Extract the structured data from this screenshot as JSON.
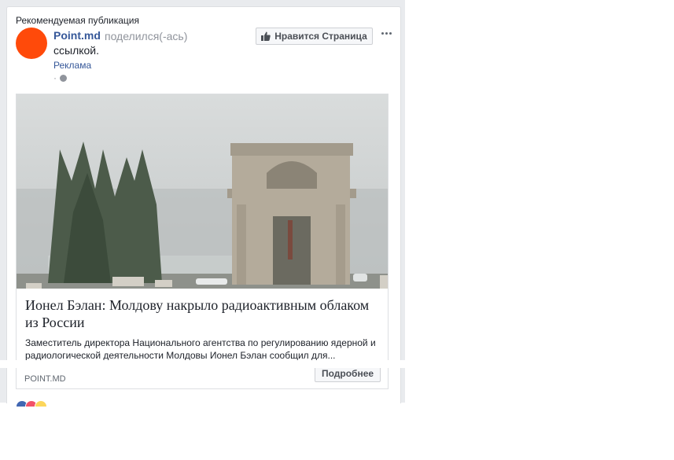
{
  "post": {
    "suggested_label": "Рекомендуемая публикация",
    "page_name": "Point.md",
    "shared_text": "поделился(-ась)",
    "link_word": "ссылкой.",
    "sponsored": "Реклама",
    "privacy_dot": "·",
    "avatar_color": "#ff4a0a",
    "like_page_label": "Нравится Страница",
    "like_icon": "thumbs-up-icon",
    "more_icon": "ellipsis-icon"
  },
  "link": {
    "headline": "Ионел Бэлан: Молдову накрыло радиоактивным облаком из России",
    "description": "Заместитель директора Национального агентства по регулированию ядерной и радиологической деятельности Молдовы Ионел Бэлан сообщил для...",
    "domain": "POINT.MD",
    "cta_label": "Подробнее",
    "image_desc": "foggy-triumphal-arch-photo"
  },
  "reactions": {
    "colors": [
      "#4267b2",
      "#f25268",
      "#fcd65b"
    ]
  }
}
